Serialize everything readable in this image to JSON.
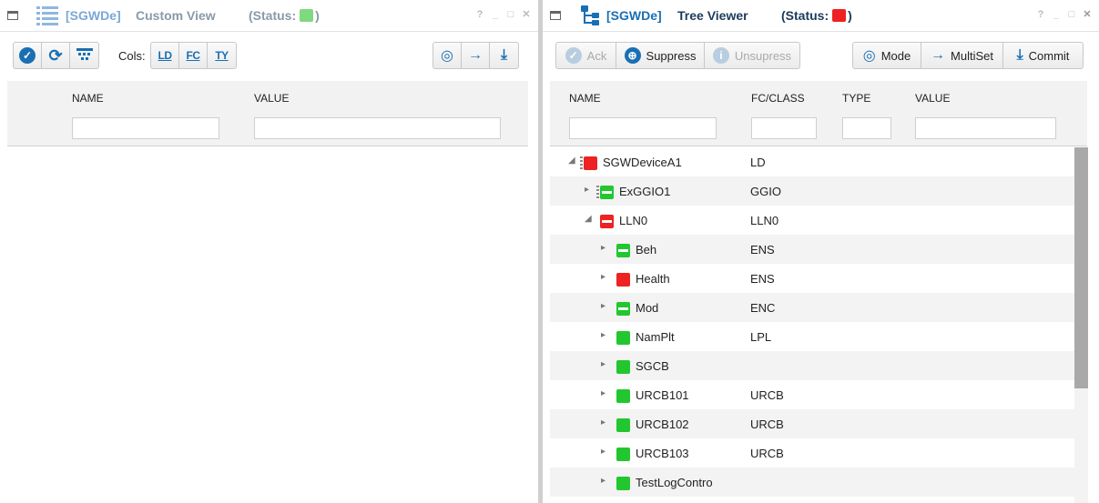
{
  "left_panel": {
    "bracket": "[SGWDe]",
    "title": "Custom View",
    "status_label": "(Status:",
    "status_close": ")",
    "status_color": "#7fd97f",
    "controls": [
      "?",
      "_",
      "□",
      "✕"
    ],
    "toolbar": {
      "cols_label": "Cols:",
      "col_buttons": [
        "LD",
        "FC",
        "TY"
      ]
    },
    "columns": [
      "NAME",
      "VALUE"
    ],
    "filters": {
      "name": "",
      "value": ""
    }
  },
  "right_panel": {
    "bracket": "[SGWDe]",
    "title": "Tree Viewer",
    "status_label": "(Status:",
    "status_close": ")",
    "status_color": "#ee2222",
    "controls": [
      "?",
      "_",
      "□",
      "✕"
    ],
    "toolbar": {
      "ack": "Ack",
      "suppress": "Suppress",
      "unsupress": "Unsupress",
      "mode": "Mode",
      "multiset": "MultiSet",
      "commit": "Commit"
    },
    "columns": [
      "NAME",
      "FC/CLASS",
      "TYPE",
      "VALUE"
    ],
    "filters": {
      "name": "",
      "fc_class": "",
      "type": "",
      "value": ""
    },
    "tree": [
      {
        "name": "SGWDeviceA1",
        "fc": "LD",
        "status": "red",
        "minus": false,
        "mark": true,
        "expander": "collapse"
      },
      {
        "name": "ExGGIO1",
        "fc": "GGIO",
        "status": "green",
        "minus": true,
        "mark": true,
        "expander": "expand"
      },
      {
        "name": "LLN0",
        "fc": "LLN0",
        "status": "red",
        "minus": true,
        "mark": false,
        "expander": "collapse"
      },
      {
        "name": "Beh",
        "fc": "ENS",
        "status": "green",
        "minus": true,
        "mark": false,
        "expander": "expand"
      },
      {
        "name": "Health",
        "fc": "ENS",
        "status": "red",
        "minus": false,
        "mark": false,
        "expander": "expand"
      },
      {
        "name": "Mod",
        "fc": "ENC",
        "status": "green",
        "minus": true,
        "mark": false,
        "expander": "expand"
      },
      {
        "name": "NamPlt",
        "fc": "LPL",
        "status": "green",
        "minus": false,
        "mark": false,
        "expander": "expand"
      },
      {
        "name": "SGCB",
        "fc": "",
        "status": "green",
        "minus": false,
        "mark": false,
        "expander": "expand"
      },
      {
        "name": "URCB101",
        "fc": "URCB",
        "status": "green",
        "minus": false,
        "mark": false,
        "expander": "expand"
      },
      {
        "name": "URCB102",
        "fc": "URCB",
        "status": "green",
        "minus": false,
        "mark": false,
        "expander": "expand"
      },
      {
        "name": "URCB103",
        "fc": "URCB",
        "status": "green",
        "minus": false,
        "mark": false,
        "expander": "expand"
      },
      {
        "name": "TestLogContro",
        "fc": "",
        "status": "green",
        "minus": false,
        "mark": false,
        "expander": "expand"
      }
    ]
  },
  "colors": {
    "accent": "#1a6fb3",
    "green": "#22c72f",
    "red": "#ee2222"
  }
}
